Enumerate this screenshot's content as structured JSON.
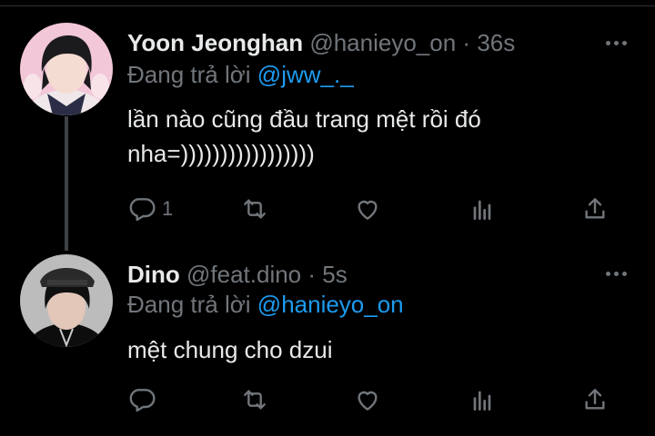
{
  "tweets": [
    {
      "name": "Yoon Jeonghan",
      "handle": "@hanieyo_on",
      "separator": "·",
      "time": "36s",
      "replying_prefix": "Đang trả lời",
      "replying_to": "@jww_._",
      "text": "lần nào cũng đầu trang mệt rồi đó nha=)))))))))))))))))",
      "reply_count": "1",
      "avatar_colors": {
        "bg": "#f2c7d8",
        "hair": "#1b1b1e",
        "skin": "#f4dcd2",
        "shirt": "#efe7ea"
      }
    },
    {
      "name": "Dino",
      "handle": "@feat.dino",
      "separator": "·",
      "time": "5s",
      "replying_prefix": "Đang trả lời",
      "replying_to": "@hanieyo_on",
      "text": "mệt chung cho dzui",
      "reply_count": "",
      "avatar_colors": {
        "bg": "#bcbcbc",
        "hair": "#101010",
        "skin": "#e3c7b9",
        "shirt": "#0d0d0d"
      }
    }
  ],
  "icons": [
    "reply-icon",
    "retweet-icon",
    "like-icon",
    "views-icon",
    "share-icon",
    "more-icon"
  ],
  "colors": {
    "background": "#000000",
    "text": "#e7e9ea",
    "muted": "#71767b",
    "accent": "#1d9bf0",
    "thread": "#3e4144"
  }
}
